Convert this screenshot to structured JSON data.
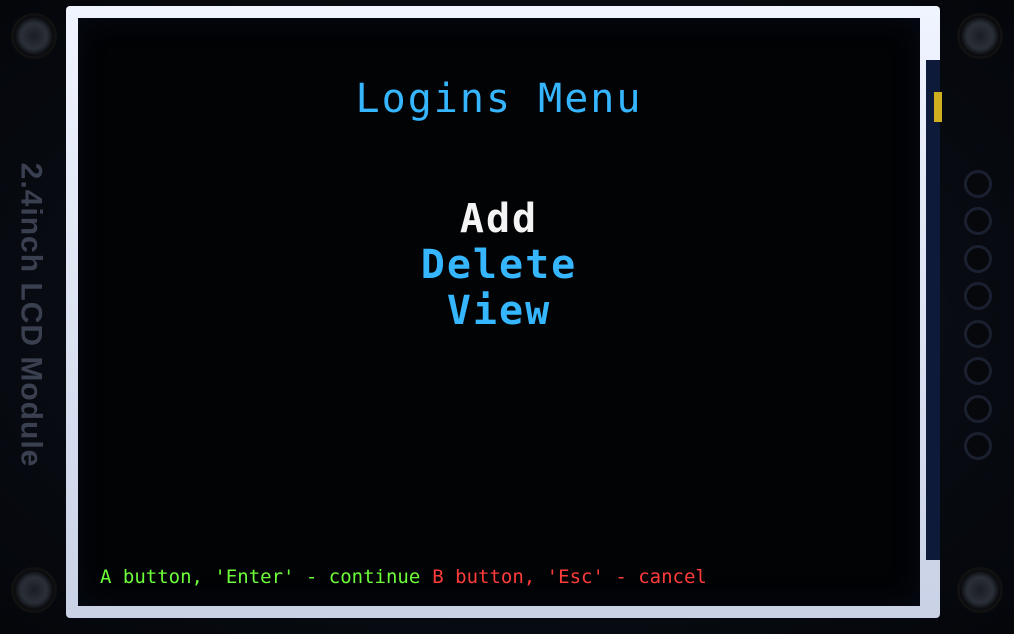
{
  "board": {
    "silkscreen_label": "2.4inch LCD Module"
  },
  "screen": {
    "title": "Logins Menu",
    "menu_items": [
      {
        "label": "Add",
        "selected": true
      },
      {
        "label": "Delete",
        "selected": false
      },
      {
        "label": "View",
        "selected": false
      }
    ],
    "footer": {
      "continue_hint": "A button, 'Enter' - continue",
      "cancel_hint": "B button, 'Esc' - cancel"
    }
  },
  "colors": {
    "menu_text": "#35b6ff",
    "selected_text": "#f4f4f4",
    "continue_hint": "#6cff3a",
    "cancel_hint": "#ff3b3b",
    "screen_background": "#020305"
  }
}
